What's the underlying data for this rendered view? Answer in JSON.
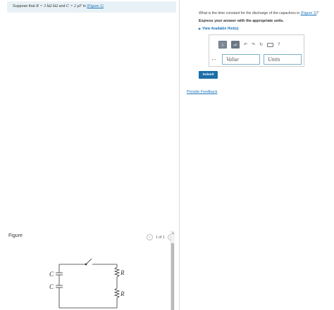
{
  "problem": {
    "intro_prefix": "Suppose that ",
    "intro_R": "R = 3 kΩ kΩ",
    "intro_mid": " and ",
    "intro_C": "C = 2 μF",
    "intro_suffix": " in ",
    "figure_link": "(Figure 1)"
  },
  "figure": {
    "label": "Figure",
    "pager_text": "1 of 1",
    "prev_glyph": "‹",
    "next_glyph": "›",
    "scroll_up_glyph": "▲",
    "circuit_labels": {
      "C_top": "C",
      "C_bottom": "C",
      "R_top": "R",
      "R_bottom": "R"
    }
  },
  "part": {
    "question": "What is the time constant for the discharge of the capacitors in ",
    "question_link": "(Figure 1)",
    "question_suffix": "?",
    "instruction": "Express your answer with the appropriate units.",
    "hints_label": "View Available Hint(s)",
    "hints_glyph": "▶",
    "answer": {
      "variable_label": "τ =",
      "value_placeholder": "Value",
      "units_placeholder": "Units",
      "toolbar": {
        "units_btn": "▯",
        "template_btn": "μÅ",
        "undo_icon": "↶",
        "redo_icon": "↷",
        "reset_icon": "↻",
        "help_icon": "?"
      }
    },
    "submit_label": "Submit"
  },
  "feedback_label": "Provide Feedback"
}
